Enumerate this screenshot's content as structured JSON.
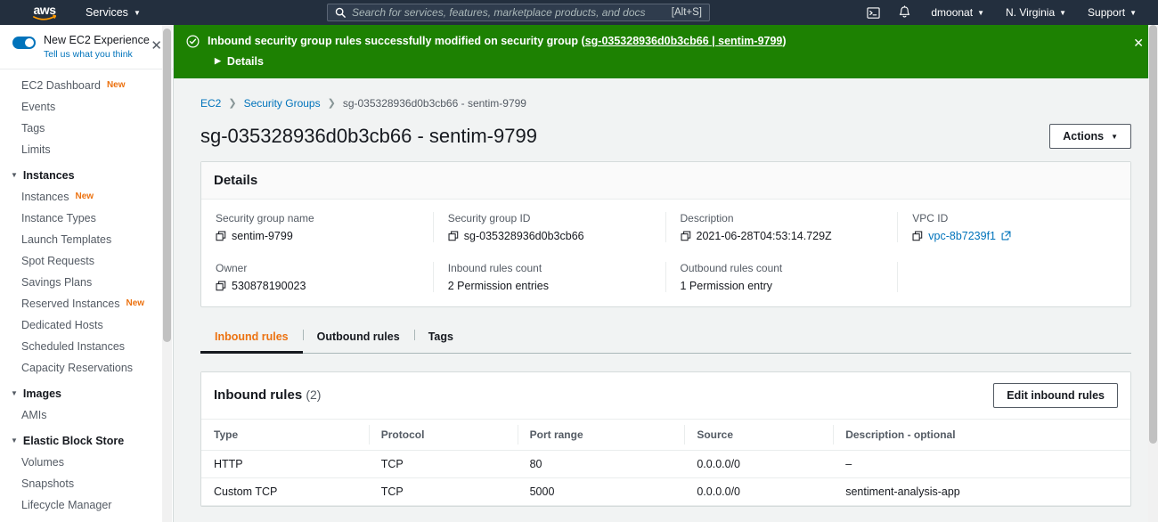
{
  "topnav": {
    "logo_text": "aws",
    "services_label": "Services",
    "search": {
      "placeholder": "Search for services, features, marketplace products, and docs",
      "value": "",
      "hint": "[Alt+S]",
      "icon": "search-icon"
    },
    "cloudshell_icon": "cloudshell-icon",
    "bell_icon": "bell-icon",
    "account": "dmoonat",
    "region": "N. Virginia",
    "support": "Support"
  },
  "sidebar": {
    "experience": {
      "title": "New EC2 Experience",
      "subtitle": "Tell us what you think",
      "toggle_on": true,
      "close_icon": "close-icon"
    },
    "items": [
      {
        "label": "EC2 Dashboard",
        "badge": "New",
        "type": "item"
      },
      {
        "label": "Events",
        "badge": "",
        "type": "item"
      },
      {
        "label": "Tags",
        "badge": "",
        "type": "item"
      },
      {
        "label": "Limits",
        "badge": "",
        "type": "item"
      },
      {
        "label": "Instances",
        "badge": "",
        "type": "group"
      },
      {
        "label": "Instances",
        "badge": "New",
        "type": "item"
      },
      {
        "label": "Instance Types",
        "badge": "",
        "type": "item"
      },
      {
        "label": "Launch Templates",
        "badge": "",
        "type": "item"
      },
      {
        "label": "Spot Requests",
        "badge": "",
        "type": "item"
      },
      {
        "label": "Savings Plans",
        "badge": "",
        "type": "item"
      },
      {
        "label": "Reserved Instances",
        "badge": "New",
        "type": "item"
      },
      {
        "label": "Dedicated Hosts",
        "badge": "",
        "type": "item"
      },
      {
        "label": "Scheduled Instances",
        "badge": "",
        "type": "item"
      },
      {
        "label": "Capacity Reservations",
        "badge": "",
        "type": "item"
      },
      {
        "label": "Images",
        "badge": "",
        "type": "group"
      },
      {
        "label": "AMIs",
        "badge": "",
        "type": "item"
      },
      {
        "label": "Elastic Block Store",
        "badge": "",
        "type": "group"
      },
      {
        "label": "Volumes",
        "badge": "",
        "type": "item"
      },
      {
        "label": "Snapshots",
        "badge": "",
        "type": "item"
      },
      {
        "label": "Lifecycle Manager",
        "badge": "",
        "type": "item"
      }
    ]
  },
  "flash": {
    "icon": "success-check-icon",
    "message_prefix": "Inbound security group rules successfully modified on security group (",
    "link_1": "sg-035328936d0b3cb66",
    "link_sep": " | ",
    "link_2": "sentim-9799",
    "message_suffix": ")",
    "details_label": "Details",
    "close_icon": "close-icon",
    "color": "#1d8102"
  },
  "breadcrumb": [
    {
      "label": "EC2",
      "link": true
    },
    {
      "label": "Security Groups",
      "link": true
    },
    {
      "label": "sg-035328936d0b3cb66 - sentim-9799",
      "link": false
    }
  ],
  "page": {
    "title": "sg-035328936d0b3cb66 - sentim-9799",
    "actions_label": "Actions"
  },
  "details": {
    "heading": "Details",
    "fields": [
      {
        "label": "Security group name",
        "value": "sentim-9799",
        "copy": true,
        "link": false
      },
      {
        "label": "Security group ID",
        "value": "sg-035328936d0b3cb66",
        "copy": true,
        "link": false
      },
      {
        "label": "Description",
        "value": "2021-06-28T04:53:14.729Z",
        "copy": true,
        "link": false
      },
      {
        "label": "VPC ID",
        "value": "vpc-8b7239f1",
        "copy": true,
        "link": true
      },
      {
        "label": "Owner",
        "value": "530878190023",
        "copy": true,
        "link": false
      },
      {
        "label": "Inbound rules count",
        "value": "2 Permission entries",
        "copy": false,
        "link": false
      },
      {
        "label": "Outbound rules count",
        "value": "1 Permission entry",
        "copy": false,
        "link": false
      },
      {
        "label": "",
        "value": "",
        "copy": false,
        "link": false
      }
    ]
  },
  "tabs": [
    {
      "label": "Inbound rules",
      "active": true
    },
    {
      "label": "Outbound rules",
      "active": false
    },
    {
      "label": "Tags",
      "active": false
    }
  ],
  "inbound_panel": {
    "title": "Inbound rules",
    "count": "(2)",
    "edit_label": "Edit inbound rules",
    "columns": [
      "Type",
      "Protocol",
      "Port range",
      "Source",
      "Description - optional"
    ],
    "rows": [
      {
        "type": "HTTP",
        "protocol": "TCP",
        "port": "80",
        "source": "0.0.0.0/0",
        "description": "–"
      },
      {
        "type": "Custom TCP",
        "protocol": "TCP",
        "port": "5000",
        "source": "0.0.0.0/0",
        "description": "sentiment-analysis-app"
      }
    ]
  }
}
